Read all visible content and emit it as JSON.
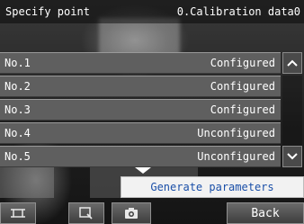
{
  "header": {
    "title": "Specify point",
    "calibration_label": "0.Calibration data0"
  },
  "points": [
    {
      "number": "No.1",
      "status": "Configured"
    },
    {
      "number": "No.2",
      "status": "Configured"
    },
    {
      "number": "No.3",
      "status": "Configured"
    },
    {
      "number": "No.4",
      "status": "Unconfigured"
    },
    {
      "number": "No.5",
      "status": "Unconfigured"
    }
  ],
  "scroll": {
    "up_icon": "chevron-up-icon",
    "down_icon": "chevron-down-icon"
  },
  "actions": {
    "generate_label": "Generate parameters"
  },
  "toolbar": {
    "back_label": "Back",
    "icons": [
      "fit-frame-icon",
      "zoom-icon",
      "camera-icon"
    ]
  },
  "colors": {
    "row_bg": "#5f5f5f",
    "generate_text": "#1a4fa8"
  }
}
